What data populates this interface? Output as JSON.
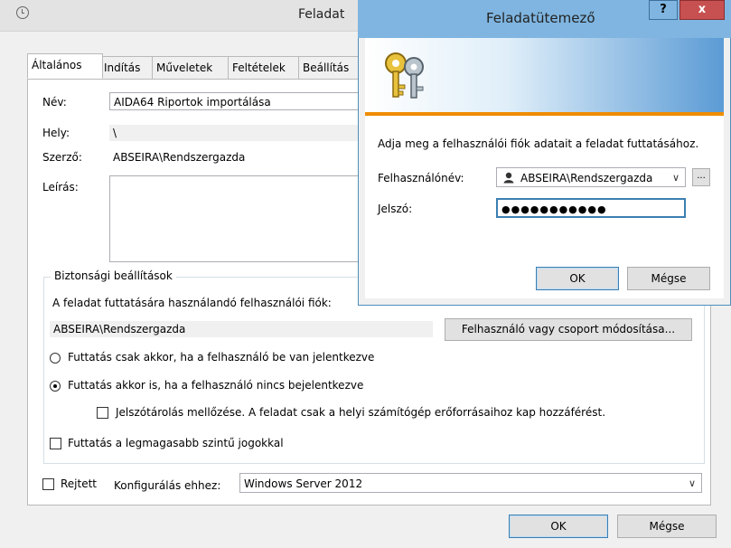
{
  "main": {
    "title": "Feladat",
    "tabs": [
      "Általános",
      "Indítás",
      "Műveletek",
      "Feltételek",
      "Beállítás"
    ],
    "name_label": "Név:",
    "name_value": "AIDA64 Riportok importálása",
    "location_label": "Hely:",
    "location_value": "\\",
    "author_label": "Szerző:",
    "author_value": "ABSEIRA\\Rendszergazda",
    "description_label": "Leírás:",
    "security": {
      "legend": "Biztonsági beállítások",
      "account_prompt": "A feladat futtatására használandó felhasználói fiók:",
      "account_value": "ABSEIRA\\Rendszergazda",
      "change_button": "Felhasználó vagy csoport módosítása...",
      "radio_logged_on": "Futtatás csak akkor, ha a felhasználó be van jelentkezve",
      "radio_always": "Futtatás akkor is, ha a felhasználó nincs bejelentkezve",
      "no_store_password": "Jelszótárolás mellőzése. A feladat csak a helyi számítógép erőforrásaihoz kap hozzáférést.",
      "highest_privileges": "Futtatás a legmagasabb szintű jogokkal"
    },
    "hidden_label": "Rejtett",
    "configure_label": "Konfigurálás ehhez:",
    "configure_value": "Windows Server 2012",
    "ok": "OK",
    "cancel": "Mégse"
  },
  "dialog": {
    "title": "Feladatütemező",
    "help": "?",
    "close": "x",
    "prompt": "Adja meg a felhasználói fiók adatait a feladat futtatásához.",
    "username_label": "Felhasználónév:",
    "username_value": "ABSEIRA\\Rendszergazda",
    "browse": "...",
    "password_label": "Jelszó:",
    "password_value": "●●●●●●●●●●●",
    "ok": "OK",
    "cancel": "Mégse"
  }
}
